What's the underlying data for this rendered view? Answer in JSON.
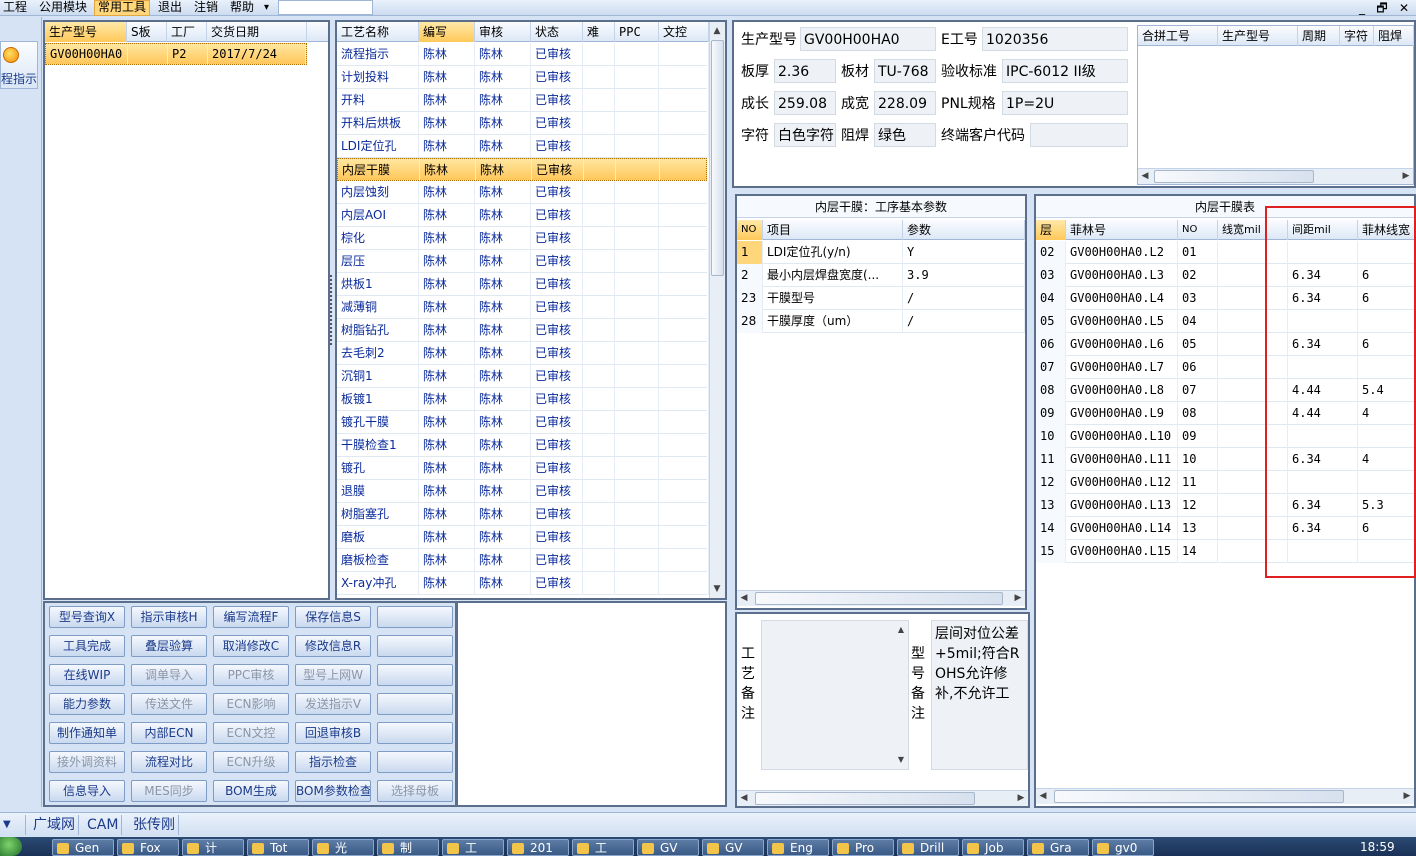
{
  "menubar": {
    "items": [
      "工程",
      "公用模块",
      "常用工具",
      "退出",
      "注销",
      "帮助"
    ],
    "active_index": 2,
    "dropdown_arrow": "▾",
    "window_controls": [
      "_",
      "🗗",
      "✕"
    ]
  },
  "nav": {
    "label": "程指示",
    "icon": "orange-circle-icon"
  },
  "model_list": {
    "columns": [
      "生产型号",
      "S板",
      "工厂",
      "交货日期"
    ],
    "rows": [
      [
        "GV00H00HA0",
        "",
        "P2",
        "2017/7/24"
      ]
    ]
  },
  "process_list": {
    "columns": [
      "工艺名称",
      "编写",
      "审核",
      "状态",
      "难",
      "PPC",
      "文控"
    ],
    "selected_row": 5,
    "rows": [
      [
        "流程指示",
        "陈林",
        "陈林",
        "已审核"
      ],
      [
        "计划投料",
        "陈林",
        "陈林",
        "已审核"
      ],
      [
        "开料",
        "陈林",
        "陈林",
        "已审核"
      ],
      [
        "开料后烘板",
        "陈林",
        "陈林",
        "已审核"
      ],
      [
        "LDI定位孔",
        "陈林",
        "陈林",
        "已审核"
      ],
      [
        "内层干膜",
        "陈林",
        "陈林",
        "已审核"
      ],
      [
        "内层蚀刻",
        "陈林",
        "陈林",
        "已审核"
      ],
      [
        "内层AOI",
        "陈林",
        "陈林",
        "已审核"
      ],
      [
        "棕化",
        "陈林",
        "陈林",
        "已审核"
      ],
      [
        "层压",
        "陈林",
        "陈林",
        "已审核"
      ],
      [
        "烘板1",
        "陈林",
        "陈林",
        "已审核"
      ],
      [
        "减薄铜",
        "陈林",
        "陈林",
        "已审核"
      ],
      [
        "树脂钻孔",
        "陈林",
        "陈林",
        "已审核"
      ],
      [
        "去毛刺2",
        "陈林",
        "陈林",
        "已审核"
      ],
      [
        "沉铜1",
        "陈林",
        "陈林",
        "已审核"
      ],
      [
        "板镀1",
        "陈林",
        "陈林",
        "已审核"
      ],
      [
        "镀孔干膜",
        "陈林",
        "陈林",
        "已审核"
      ],
      [
        "干膜检查1",
        "陈林",
        "陈林",
        "已审核"
      ],
      [
        "镀孔",
        "陈林",
        "陈林",
        "已审核"
      ],
      [
        "退膜",
        "陈林",
        "陈林",
        "已审核"
      ],
      [
        "树脂塞孔",
        "陈林",
        "陈林",
        "已审核"
      ],
      [
        "磨板",
        "陈林",
        "陈林",
        "已审核"
      ],
      [
        "磨板检查",
        "陈林",
        "陈林",
        "已审核"
      ],
      [
        "X-ray冲孔",
        "陈林",
        "陈林",
        "已审核"
      ]
    ]
  },
  "toolbar": {
    "rows": [
      [
        {
          "label": "型号查询X",
          "enabled": true
        },
        {
          "label": "指示审核H",
          "enabled": true
        },
        {
          "label": "编写流程F",
          "enabled": true
        },
        {
          "label": "保存信息S",
          "enabled": true
        },
        {
          "label": "",
          "enabled": true
        }
      ],
      [
        {
          "label": "工具完成",
          "enabled": true
        },
        {
          "label": "叠层验算",
          "enabled": true
        },
        {
          "label": "取消修改C",
          "enabled": true
        },
        {
          "label": "修改信息R",
          "enabled": true
        },
        {
          "label": "",
          "enabled": true
        }
      ],
      [
        {
          "label": "在线WIP",
          "enabled": true
        },
        {
          "label": "调单导入",
          "enabled": false
        },
        {
          "label": "PPC审核",
          "enabled": false
        },
        {
          "label": "型号上网W",
          "enabled": false
        },
        {
          "label": "",
          "enabled": true
        }
      ],
      [
        {
          "label": "能力参数",
          "enabled": true
        },
        {
          "label": "传送文件",
          "enabled": false
        },
        {
          "label": "ECN影响",
          "enabled": false
        },
        {
          "label": "发送指示V",
          "enabled": false
        },
        {
          "label": "",
          "enabled": true
        }
      ],
      [
        {
          "label": "制作通知单",
          "enabled": true
        },
        {
          "label": "内部ECN",
          "enabled": true
        },
        {
          "label": "ECN文控",
          "enabled": false
        },
        {
          "label": "回退审核B",
          "enabled": true
        },
        {
          "label": "",
          "enabled": true
        }
      ],
      [
        {
          "label": "接外调资料",
          "enabled": false
        },
        {
          "label": "流程对比",
          "enabled": true
        },
        {
          "label": "ECN升级",
          "enabled": false
        },
        {
          "label": "指示检查",
          "enabled": true
        },
        {
          "label": "",
          "enabled": true
        }
      ],
      [
        {
          "label": "信息导入",
          "enabled": true
        },
        {
          "label": "MES同步",
          "enabled": false
        },
        {
          "label": "BOM生成",
          "enabled": true
        },
        {
          "label": "BOM参数检查",
          "enabled": true
        },
        {
          "label": "选择母板",
          "enabled": false
        }
      ]
    ]
  },
  "info": {
    "model_label": "生产型号",
    "model_value": "GV00H00HA0",
    "eno_label": "E工号",
    "eno_value": "1020356",
    "thickness_label": "板厚",
    "thickness_value": "2.36",
    "material_label": "板材",
    "material_value": "TU-768",
    "standard_label": "验收标准",
    "standard_value": "IPC-6012 II级",
    "length_label": "成长",
    "length_value": "259.08",
    "width_label": "成宽",
    "width_value": "228.09",
    "pnl_label": "PNL规格",
    "pnl_value": "1P=2U",
    "char_label": "字符",
    "char_value": "白色字符",
    "mask_label": "阻焊",
    "mask_value": "绿色",
    "customer_label": "终端客户代码",
    "customer_value": ""
  },
  "combined": {
    "columns": [
      "合拼工号",
      "生产型号",
      "周期",
      "字符",
      "阻焊"
    ]
  },
  "params": {
    "title": "内层干膜：工序基本参数",
    "columns": [
      "NO",
      "项目",
      "参数"
    ],
    "rows": [
      [
        "1",
        "LDI定位孔(y/n)",
        "Y"
      ],
      [
        "2",
        "最小内层焊盘宽度(...",
        "3.9"
      ],
      [
        "23",
        "干膜型号",
        "/"
      ],
      [
        "28",
        "干膜厚度（um）",
        "/"
      ]
    ]
  },
  "film": {
    "title": "内层干膜表",
    "columns": [
      "层",
      "菲林号",
      "NO",
      "线宽mil",
      "间距mil",
      "菲林线宽"
    ],
    "rows": [
      [
        "02",
        "GV00H00HA0.L2",
        "01",
        "",
        "",
        ""
      ],
      [
        "03",
        "GV00H00HA0.L3",
        "02",
        "",
        "6.34",
        "6"
      ],
      [
        "04",
        "GV00H00HA0.L4",
        "03",
        "",
        "6.34",
        "6"
      ],
      [
        "05",
        "GV00H00HA0.L5",
        "04",
        "",
        "",
        ""
      ],
      [
        "06",
        "GV00H00HA0.L6",
        "05",
        "",
        "6.34",
        "6"
      ],
      [
        "07",
        "GV00H00HA0.L7",
        "06",
        "",
        "",
        ""
      ],
      [
        "08",
        "GV00H00HA0.L8",
        "07",
        "",
        "4.44",
        "5.4"
      ],
      [
        "09",
        "GV00H00HA0.L9",
        "08",
        "",
        "4.44",
        "4"
      ],
      [
        "10",
        "GV00H00HA0.L10",
        "09",
        "",
        "",
        ""
      ],
      [
        "11",
        "GV00H00HA0.L11",
        "10",
        "",
        "6.34",
        "4"
      ],
      [
        "12",
        "GV00H00HA0.L12",
        "11",
        "",
        "",
        ""
      ],
      [
        "13",
        "GV00H00HA0.L13",
        "12",
        "",
        "6.34",
        "5.3"
      ],
      [
        "14",
        "GV00H00HA0.L14",
        "13",
        "",
        "6.34",
        "6"
      ],
      [
        "15",
        "GV00H00HA0.L15",
        "14",
        "",
        "",
        ""
      ]
    ]
  },
  "notes": {
    "process_label": "工艺备注",
    "model_label": "型号备注",
    "model_text": "层间对位公差+5mil;符合ROHS允许修补,不允许工"
  },
  "statusbar": {
    "tabs": [
      "广域网",
      "CAM",
      "张传刚"
    ]
  },
  "taskbar": {
    "items": [
      "Gen",
      "Fox",
      "计",
      "Tot",
      "光",
      "制",
      "工",
      "201",
      "工",
      "GV",
      "GV",
      "Eng",
      "Pro",
      "Drill",
      "Job",
      "Gra",
      "gv0"
    ],
    "clock": "18:59"
  },
  "colors": {
    "accent": "#ffc95a",
    "highlight_box": "#e02020",
    "link_text": "#0a2a9a"
  }
}
